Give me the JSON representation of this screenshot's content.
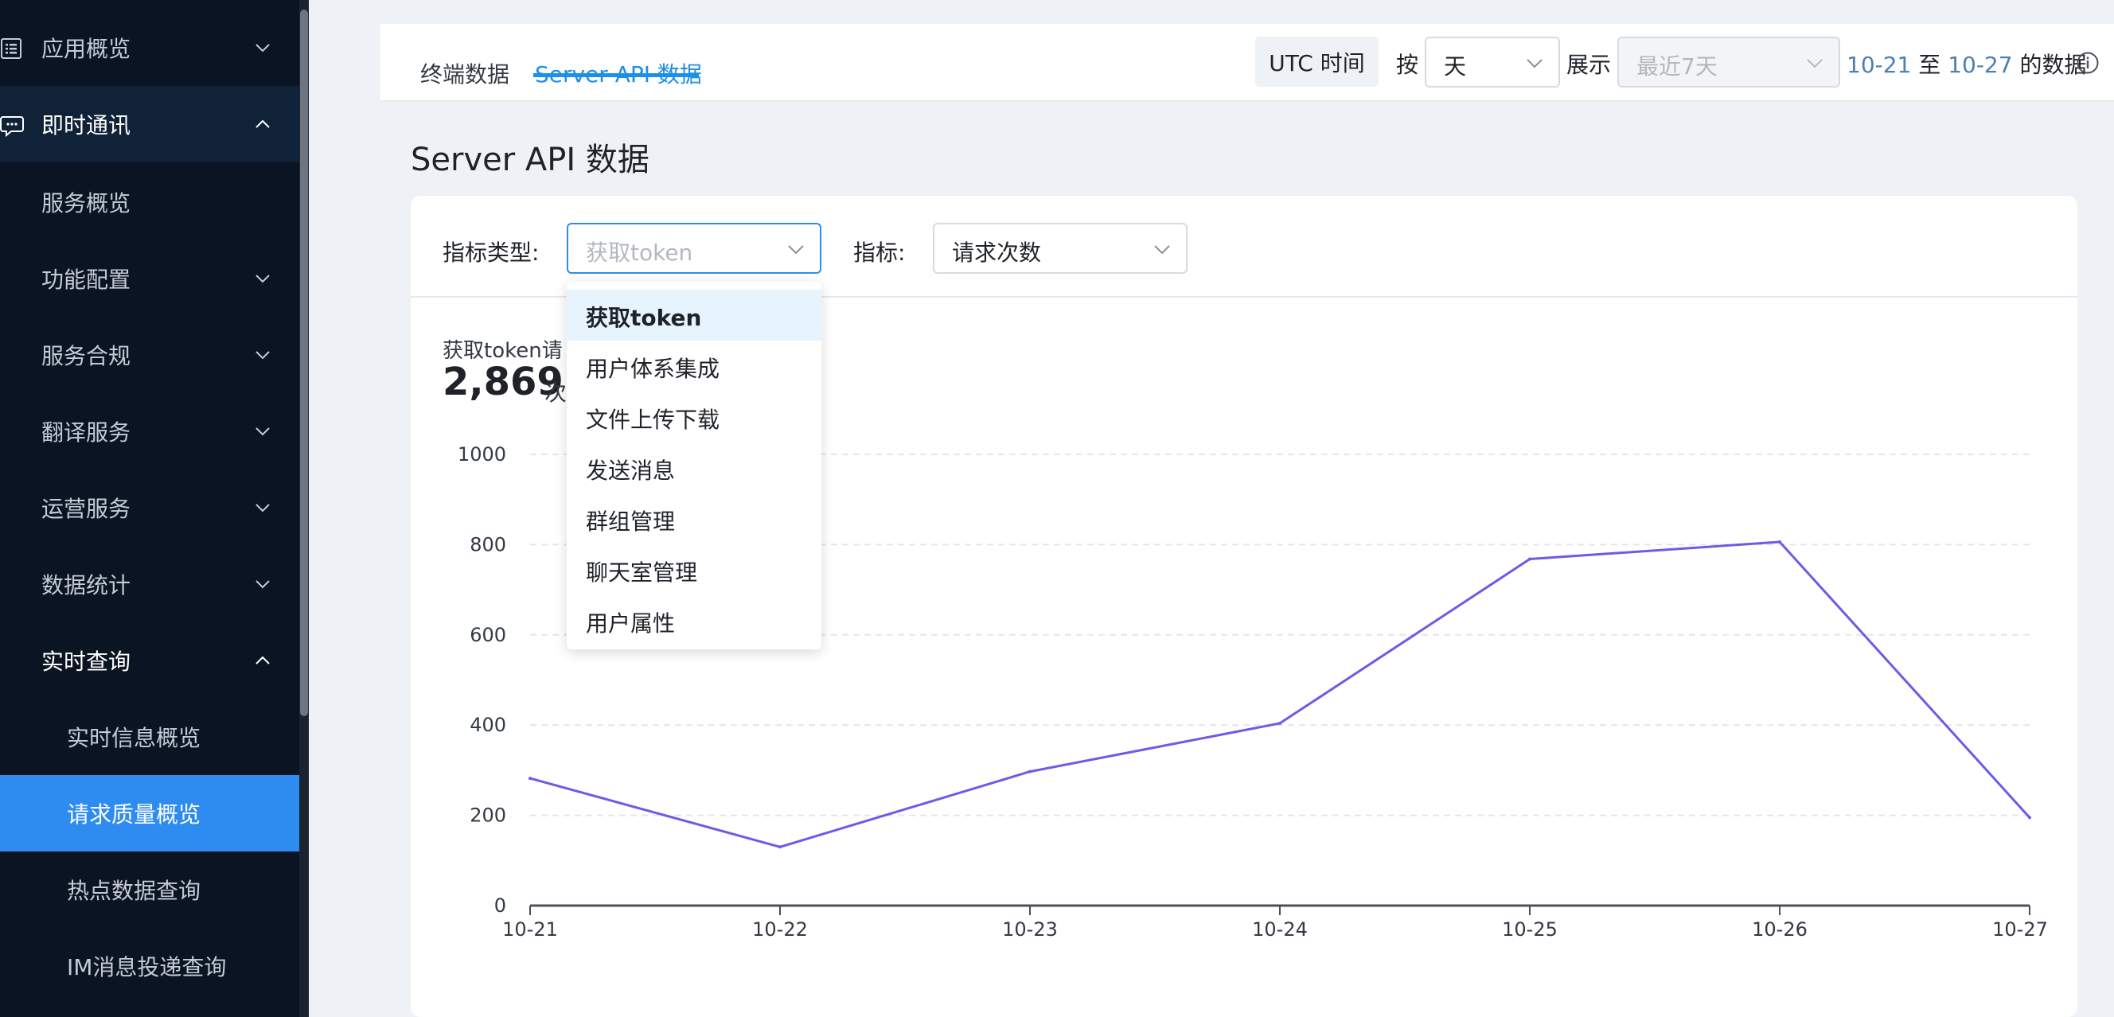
{
  "sidebar": {
    "items": [
      {
        "label": "应用概览",
        "kind": "parent",
        "expanded": false,
        "icon": "list-icon"
      },
      {
        "label": "即时通讯",
        "kind": "parent",
        "expanded": true,
        "icon": "chat-icon"
      },
      {
        "label": "服务概览",
        "kind": "child"
      },
      {
        "label": "功能配置",
        "kind": "child-parent",
        "expanded": false
      },
      {
        "label": "服务合规",
        "kind": "child-parent",
        "expanded": false
      },
      {
        "label": "翻译服务",
        "kind": "child-parent",
        "expanded": false
      },
      {
        "label": "运营服务",
        "kind": "child-parent",
        "expanded": false
      },
      {
        "label": "数据统计",
        "kind": "child-parent",
        "expanded": false
      },
      {
        "label": "实时查询",
        "kind": "child-parent",
        "expanded": true
      },
      {
        "label": "实时信息概览",
        "kind": "grandchild"
      },
      {
        "label": "请求质量概览",
        "kind": "grandchild",
        "active": true
      },
      {
        "label": "热点数据查询",
        "kind": "grandchild"
      },
      {
        "label": "IM消息投递查询",
        "kind": "grandchild"
      }
    ]
  },
  "header": {
    "tabs": [
      {
        "label": "终端数据",
        "active": false
      },
      {
        "label": "Server API 数据",
        "active": true
      }
    ],
    "utc_label": "UTC 时间",
    "by_label": "按",
    "granularity_value": "天",
    "show_label": "展示",
    "range_value": "最近7天",
    "range_start": "10-21",
    "range_to": "至",
    "range_end": "10-27",
    "range_suffix": "的数据"
  },
  "page": {
    "title": "Server API 数据",
    "metric_type_label": "指标类型:",
    "metric_type_value": "获取token",
    "metric_label": "指标:",
    "metric_value": "请求次数",
    "stat_title": "获取token请",
    "stat_value": "2,869",
    "stat_unit": "次"
  },
  "dropdown": {
    "options": [
      {
        "label": "获取token",
        "selected": true
      },
      {
        "label": "用户体系集成",
        "selected": false
      },
      {
        "label": "文件上传下载",
        "selected": false
      },
      {
        "label": "发送消息",
        "selected": false
      },
      {
        "label": "群组管理",
        "selected": false
      },
      {
        "label": "聊天室管理",
        "selected": false
      },
      {
        "label": "用户属性",
        "selected": false
      }
    ]
  },
  "colors": {
    "accent": "#1e8fe8",
    "line": "#6b5ce7",
    "sidebar_bg": "#0b1422",
    "active_item": "#2e8cf0"
  },
  "chart_data": {
    "type": "line",
    "x": [
      "10-21",
      "10-22",
      "10-23",
      "10-24",
      "10-25",
      "10-26",
      "10-27"
    ],
    "series": [
      {
        "values": [
          282,
          130,
          297,
          404,
          768,
          806,
          195
        ]
      }
    ],
    "yticks": [
      0,
      200,
      400,
      600,
      800,
      1000
    ],
    "ylim": [
      0,
      1000
    ],
    "grid": true
  }
}
